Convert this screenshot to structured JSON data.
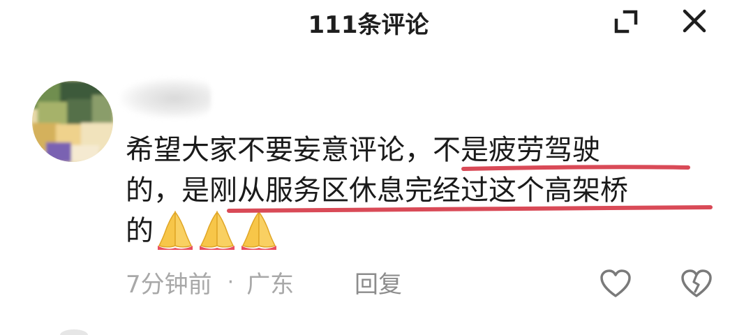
{
  "header": {
    "title": "111条评论",
    "expand_icon": "expand-icon",
    "close_icon": "close-icon"
  },
  "comment": {
    "line1_plain": "希望大家不要妄意评论，",
    "line1_highlight": "不是疲劳驾驶",
    "line2_plain": "的，是",
    "line2_highlight": "刚从服务区休息完经过这个高架桥",
    "line3": "的",
    "emojis": [
      "🙏",
      "🙏",
      "🙏"
    ],
    "underline_color": "#d94a57",
    "time": "7分钟前",
    "separator": "·",
    "location": "广东",
    "reply_label": "回复",
    "like_icon": "heart-outline-icon",
    "dislike_icon": "broken-heart-icon"
  }
}
